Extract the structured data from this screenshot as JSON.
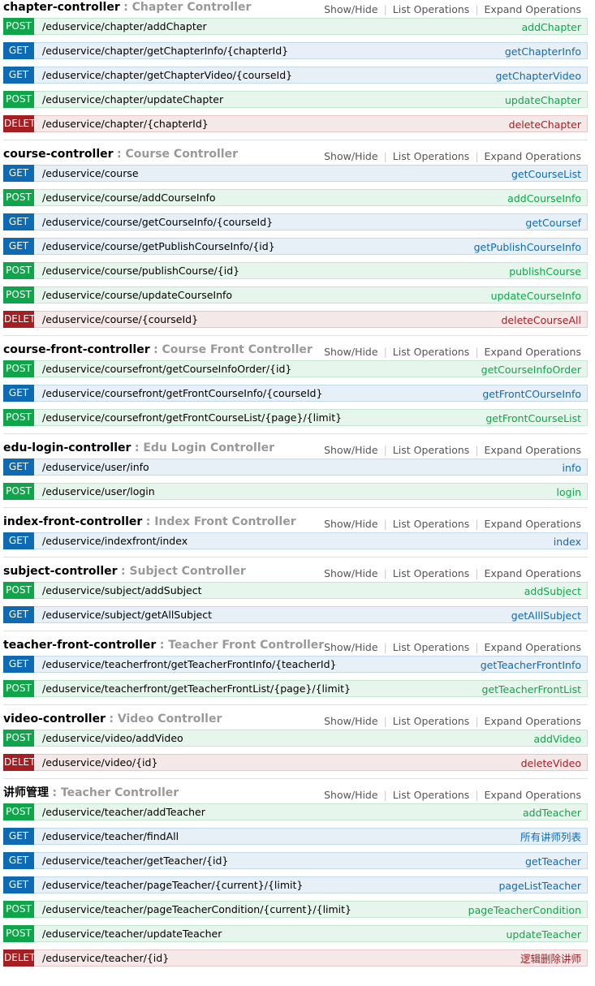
{
  "links": {
    "show_hide": "Show/Hide",
    "list_operations": "List Operations",
    "expand_operations": "Expand Operations"
  },
  "sections": [
    {
      "name": "chapter-controller",
      "description": ": Chapter Controller",
      "operations": [
        {
          "method": "POST",
          "path": "/eduservice/chapter/addChapter",
          "nickname": "addChapter"
        },
        {
          "method": "GET",
          "path": "/eduservice/chapter/getChapterInfo/{chapterId}",
          "nickname": "getChapterInfo"
        },
        {
          "method": "GET",
          "path": "/eduservice/chapter/getChapterVideo/{courseId}",
          "nickname": "getChapterVideo"
        },
        {
          "method": "POST",
          "path": "/eduservice/chapter/updateChapter",
          "nickname": "updateChapter"
        },
        {
          "method": "DELETE",
          "path": "/eduservice/chapter/{chapterId}",
          "nickname": "deleteChapter"
        }
      ]
    },
    {
      "name": "course-controller",
      "description": ": Course Controller",
      "operations": [
        {
          "method": "GET",
          "path": "/eduservice/course",
          "nickname": "getCourseList"
        },
        {
          "method": "POST",
          "path": "/eduservice/course/addCourseInfo",
          "nickname": "addCourseInfo"
        },
        {
          "method": "GET",
          "path": "/eduservice/course/getCourseInfo/{courseId}",
          "nickname": "getCoursef"
        },
        {
          "method": "GET",
          "path": "/eduservice/course/getPublishCourseInfo/{id}",
          "nickname": "getPublishCourseInfo"
        },
        {
          "method": "POST",
          "path": "/eduservice/course/publishCourse/{id}",
          "nickname": "publishCourse"
        },
        {
          "method": "POST",
          "path": "/eduservice/course/updateCourseInfo",
          "nickname": "updateCourseInfo"
        },
        {
          "method": "DELETE",
          "path": "/eduservice/course/{courseId}",
          "nickname": "deleteCourseAll"
        }
      ]
    },
    {
      "name": "course-front-controller",
      "description": ": Course Front Controller",
      "operations": [
        {
          "method": "POST",
          "path": "/eduservice/coursefront/getCourseInfoOrder/{id}",
          "nickname": "getCourseInfoOrder"
        },
        {
          "method": "GET",
          "path": "/eduservice/coursefront/getFrontCourseInfo/{courseId}",
          "nickname": "getFrontCOurseInfo"
        },
        {
          "method": "POST",
          "path": "/eduservice/coursefront/getFrontCourseList/{page}/{limit}",
          "nickname": "getFrontCourseList"
        }
      ]
    },
    {
      "name": "edu-login-controller",
      "description": ": Edu Login Controller",
      "operations": [
        {
          "method": "GET",
          "path": "/eduservice/user/info",
          "nickname": "info"
        },
        {
          "method": "POST",
          "path": "/eduservice/user/login",
          "nickname": "login"
        }
      ]
    },
    {
      "name": "index-front-controller",
      "description": ": Index Front Controller",
      "operations": [
        {
          "method": "GET",
          "path": "/eduservice/indexfront/index",
          "nickname": "index"
        }
      ]
    },
    {
      "name": "subject-controller",
      "description": ": Subject Controller",
      "operations": [
        {
          "method": "POST",
          "path": "/eduservice/subject/addSubject",
          "nickname": "addSubject"
        },
        {
          "method": "GET",
          "path": "/eduservice/subject/getAllSubject",
          "nickname": "getAlllSubject"
        }
      ]
    },
    {
      "name": "teacher-front-controller",
      "description": ": Teacher Front Controller",
      "operations": [
        {
          "method": "GET",
          "path": "/eduservice/teacherfront/getTeacherFrontInfo/{teacherId}",
          "nickname": "getTeacherFrontInfo"
        },
        {
          "method": "POST",
          "path": "/eduservice/teacherfront/getTeacherFrontList/{page}/{limit}",
          "nickname": "getTeacherFrontList"
        }
      ]
    },
    {
      "name": "video-controller",
      "description": ": Video Controller",
      "operations": [
        {
          "method": "POST",
          "path": "/eduservice/video/addVideo",
          "nickname": "addVideo"
        },
        {
          "method": "DELETE",
          "path": "/eduservice/video/{id}",
          "nickname": "deleteVideo"
        }
      ]
    },
    {
      "name": "讲师管理",
      "description": ": Teacher Controller",
      "operations": [
        {
          "method": "POST",
          "path": "/eduservice/teacher/addTeacher",
          "nickname": "addTeacher"
        },
        {
          "method": "GET",
          "path": "/eduservice/teacher/findAll",
          "nickname": "所有讲师列表"
        },
        {
          "method": "GET",
          "path": "/eduservice/teacher/getTeacher/{id}",
          "nickname": "getTeacher"
        },
        {
          "method": "GET",
          "path": "/eduservice/teacher/pageTeacher/{current}/{limit}",
          "nickname": "pageListTeacher"
        },
        {
          "method": "POST",
          "path": "/eduservice/teacher/pageTeacherCondition/{current}/{limit}",
          "nickname": "pageTeacherCondition"
        },
        {
          "method": "POST",
          "path": "/eduservice/teacher/updateTeacher",
          "nickname": "updateTeacher"
        },
        {
          "method": "DELETE",
          "path": "/eduservice/teacher/{id}",
          "nickname": "逻辑删除讲师"
        }
      ]
    }
  ]
}
